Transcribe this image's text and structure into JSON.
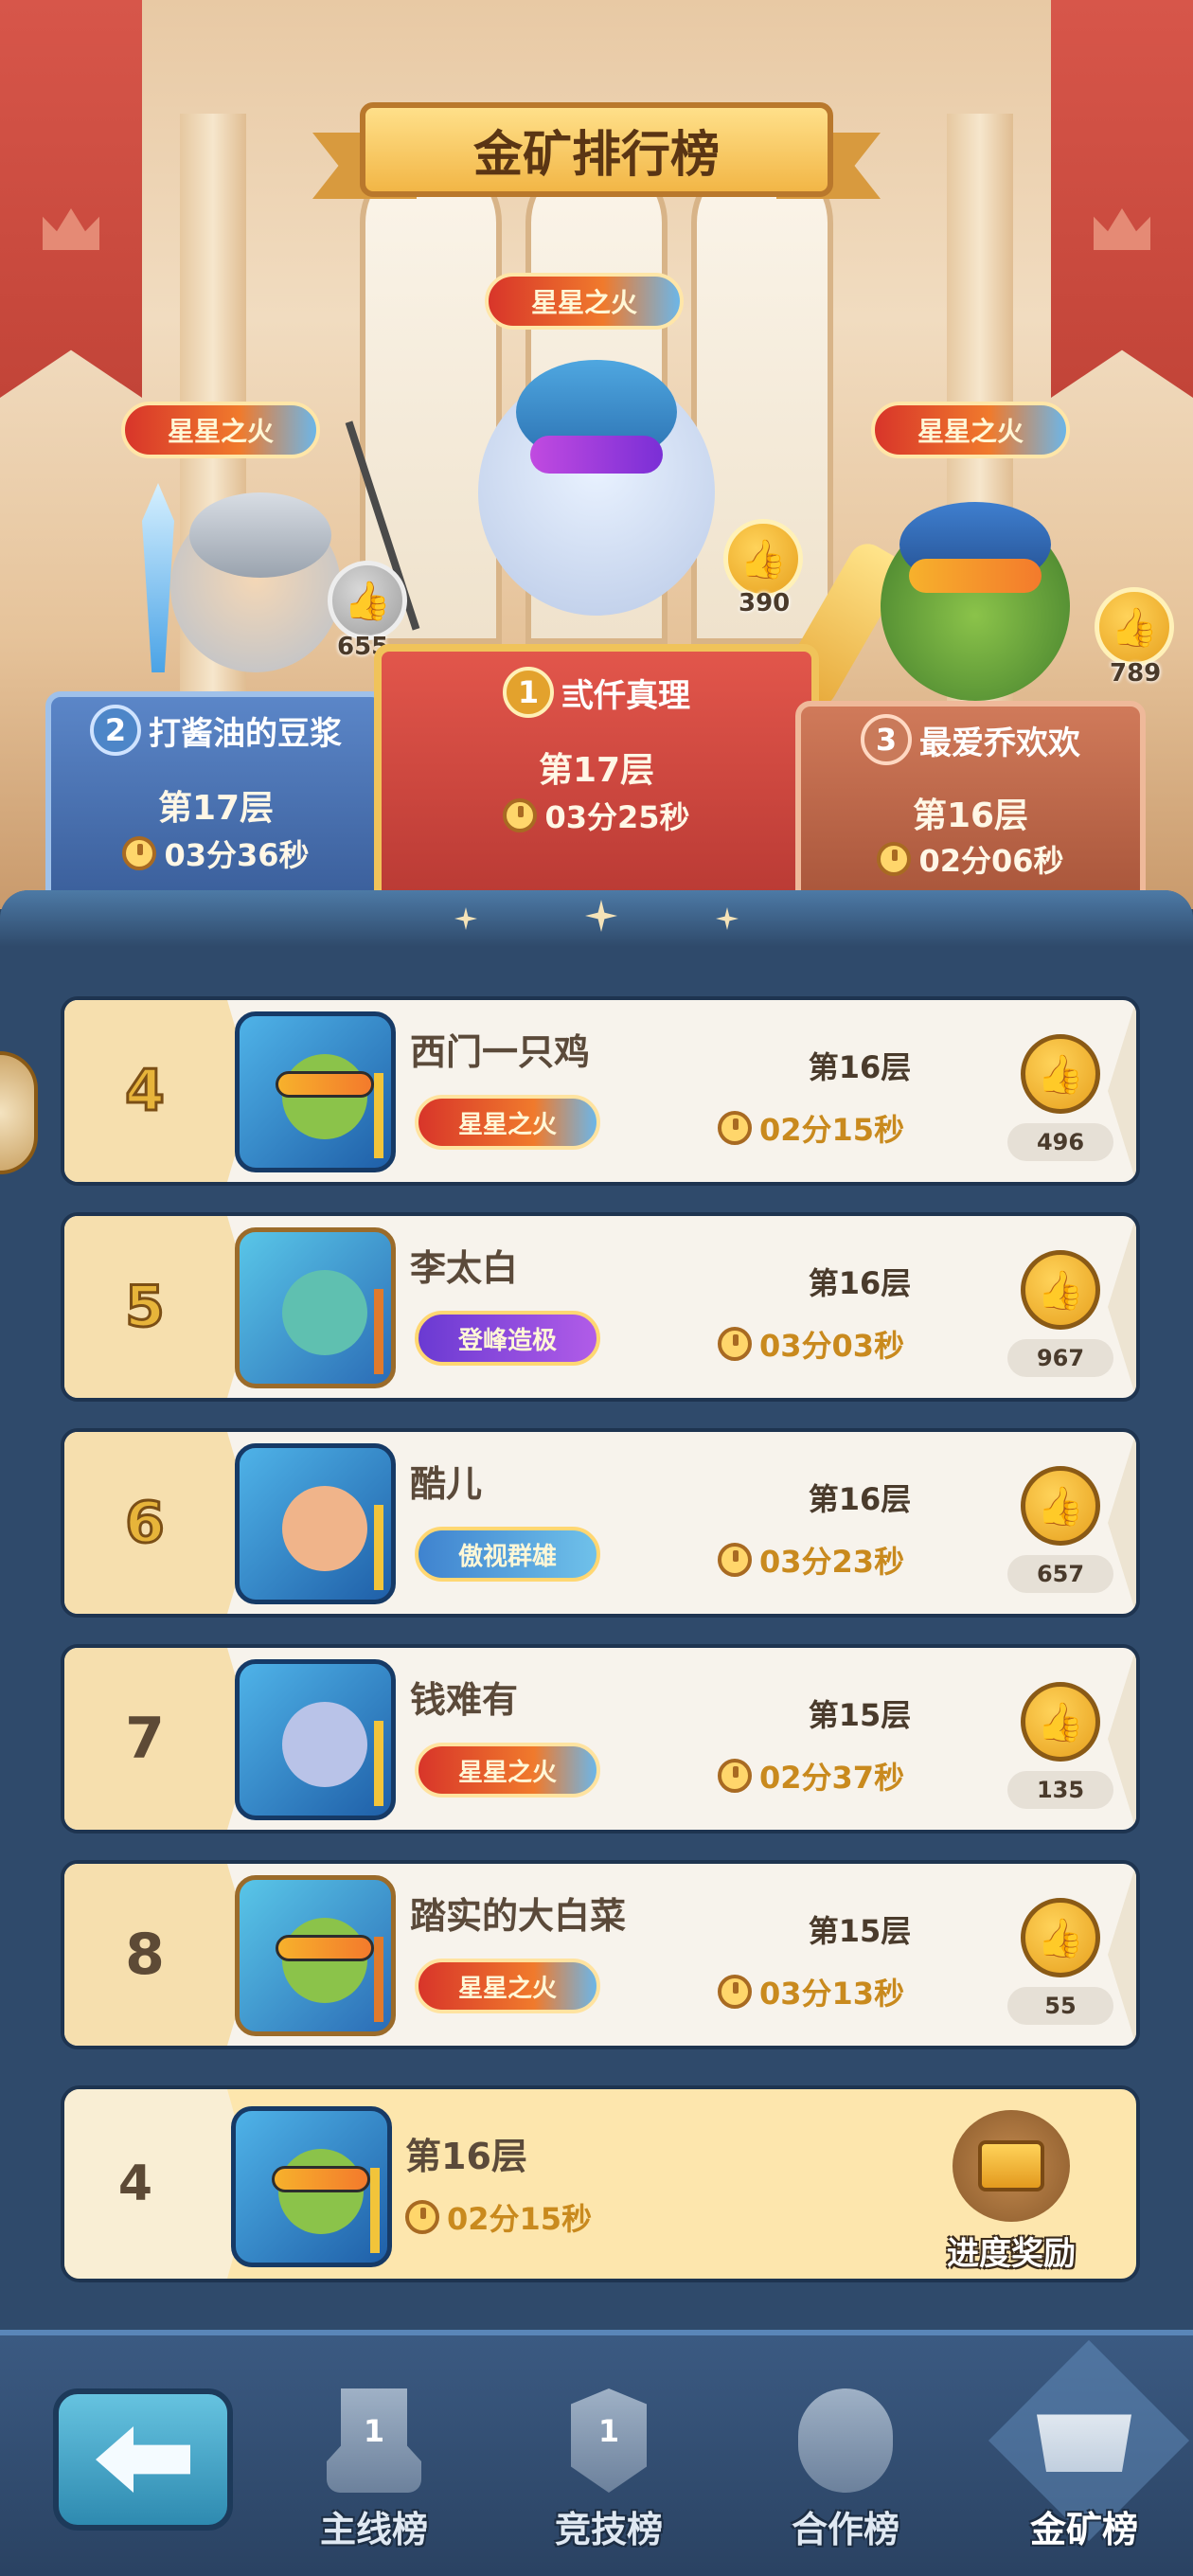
{
  "header": {
    "title": "金矿排行榜"
  },
  "podium": {
    "first": {
      "rank": "1",
      "name": "弎仟真理",
      "floor": "第17层",
      "time": "03分25秒",
      "likes": "390",
      "title": "星星之火"
    },
    "second": {
      "rank": "2",
      "name": "打酱油的豆浆",
      "floor": "第17层",
      "time": "03分36秒",
      "likes": "655",
      "title": "星星之火"
    },
    "third": {
      "rank": "3",
      "name": "最爱乔欢欢",
      "floor": "第16层",
      "time": "02分06秒",
      "likes": "789",
      "title": "星星之火"
    }
  },
  "rows": [
    {
      "rank": "4",
      "name": "西门一只鸡",
      "title": "星星之火",
      "floor": "第16层",
      "time": "02分15秒",
      "likes": "496"
    },
    {
      "rank": "5",
      "name": "李太白",
      "title": "登峰造极",
      "floor": "第16层",
      "time": "03分03秒",
      "likes": "967"
    },
    {
      "rank": "6",
      "name": "酷儿",
      "title": "傲视群雄",
      "floor": "第16层",
      "time": "03分23秒",
      "likes": "657"
    },
    {
      "rank": "7",
      "name": "钱难有",
      "title": "星星之火",
      "floor": "第15层",
      "time": "02分37秒",
      "likes": "135"
    },
    {
      "rank": "8",
      "name": "踏实的大白菜",
      "title": "星星之火",
      "floor": "第15层",
      "time": "03分13秒",
      "likes": "55"
    }
  ],
  "self": {
    "rank": "4",
    "floor": "第16层",
    "time": "02分15秒",
    "reward_label": "进度奖励"
  },
  "nav": {
    "items": [
      {
        "label": "主线榜",
        "icon_num": "1",
        "icon": "trophy-icon"
      },
      {
        "label": "竞技榜",
        "icon_num": "1",
        "icon": "shield-icon"
      },
      {
        "label": "合作榜",
        "icon": "handshake-icon"
      },
      {
        "label": "金矿榜",
        "icon": "mine-cart-icon"
      }
    ],
    "active": "金矿榜"
  },
  "colors": {
    "accent_gold": "#e7b43a",
    "time_orange": "#c98a1e",
    "panel_blue": "#2f4a6b"
  }
}
